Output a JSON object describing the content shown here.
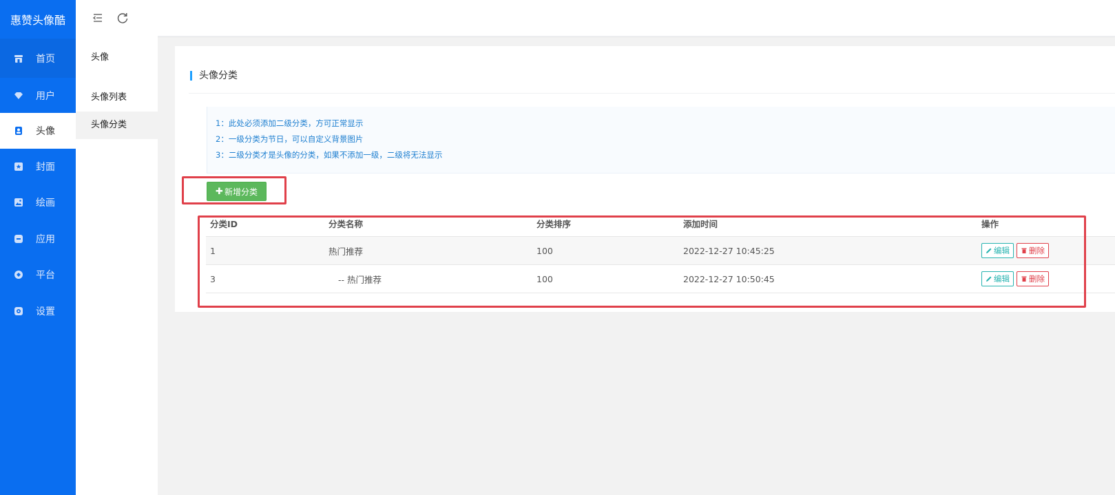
{
  "brand": "惠赞头像酷",
  "colors": {
    "sidebar": "#0a6ef0",
    "accent": "#1e9fff",
    "add_button": "#5cb85c",
    "delete": "#e0404a",
    "edit": "#26b3b0"
  },
  "nav": [
    {
      "label": "首页",
      "icon": "store-icon"
    },
    {
      "label": "用户",
      "icon": "diamond-icon"
    },
    {
      "label": "头像",
      "icon": "id-card-icon"
    },
    {
      "label": "封面",
      "icon": "star-box-icon"
    },
    {
      "label": "绘画",
      "icon": "image-icon"
    },
    {
      "label": "应用",
      "icon": "app-icon"
    },
    {
      "label": "平台",
      "icon": "circle-dot-icon"
    },
    {
      "label": "设置",
      "icon": "gear-icon"
    }
  ],
  "active_nav": "头像",
  "submenu": {
    "title": "头像",
    "items": [
      "头像列表",
      "头像分类"
    ],
    "active": "头像分类"
  },
  "topbar": {
    "menu_icon": "collapse-menu-icon",
    "refresh_icon": "refresh-icon"
  },
  "page": {
    "title": "头像分类",
    "notices": [
      "1：此处必须添加二级分类，方可正常显示",
      "2：一级分类为节日，可以自定义背景图片",
      "3：二级分类才是头像的分类，如果不添加一级，二级将无法显示"
    ],
    "add_button": "新增分类"
  },
  "table": {
    "columns": [
      "分类ID",
      "分类名称",
      "分类排序",
      "添加时间",
      "操作"
    ],
    "rows": [
      {
        "id": "1",
        "name": "热门推荐",
        "sort": "100",
        "time": "2022-12-27 10:45:25"
      },
      {
        "id": "3",
        "name": "-- 热门推荐",
        "sort": "100",
        "time": "2022-12-27 10:50:45"
      }
    ],
    "edit_label": "编辑",
    "delete_label": "删除"
  }
}
